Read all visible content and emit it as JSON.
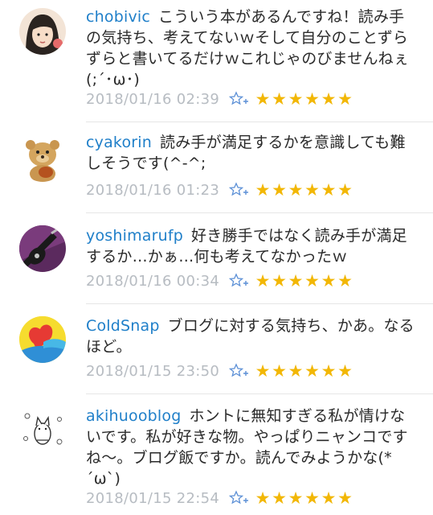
{
  "colors": {
    "username": "#1f7fc9",
    "text": "#2a2a2a",
    "timestamp": "#b7bcc2",
    "star": "#f2b705",
    "add_star": "#5b8fd6"
  },
  "comments": [
    {
      "username": "chobivic",
      "text": "こういう本があるんですね！読み手の気持ち、考えてないｗそして自分のことずらずらと書いてるだけｗこれじゃのびませんねぇ(;´･ω･)",
      "timestamp": "2018/01/16 02:39",
      "stars": [
        "★",
        "★",
        "★",
        "★",
        "★",
        "★"
      ]
    },
    {
      "username": "cyakorin",
      "text": "読み手が満足するかを意識しても難しそうです(^-^;",
      "timestamp": "2018/01/16 01:23",
      "stars": [
        "★",
        "★",
        "★",
        "★",
        "★",
        "★"
      ]
    },
    {
      "username": "yoshimarufp",
      "text": "好き勝手ではなく読み手が満足するか…かぁ…何も考えてなかったｗ",
      "timestamp": "2018/01/16 00:34",
      "stars": [
        "★",
        "★",
        "★",
        "★",
        "★",
        "★"
      ]
    },
    {
      "username": "ColdSnap",
      "text": "ブログに対する気持ち、かあ。なるほど。",
      "timestamp": "2018/01/15 23:50",
      "stars": [
        "★",
        "★",
        "★",
        "★",
        "★",
        "★"
      ]
    },
    {
      "username": "akihuooblog",
      "text": "ホントに無知すぎる私が情けないです。私が好きな物。やっぱりニャンコですね～。ブログ飯ですか。読んでみようかな(*´ω`)",
      "timestamp": "2018/01/15 22:54",
      "stars": [
        "★",
        "★",
        "★",
        "★",
        "★",
        "★"
      ]
    }
  ]
}
